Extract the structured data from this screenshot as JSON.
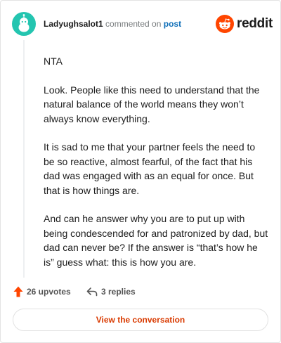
{
  "header": {
    "username": "Ladyughsalot1",
    "commented_on_text": "commented on",
    "post_link": "post",
    "brand_name": "reddit"
  },
  "comment": {
    "paragraphs": [
      "NTA",
      "Look. People like this need to understand that the natural balance of the world means they won’t always know everything.",
      "It is sad to me that your partner feels the need to be so reactive, almost fearful, of the fact that his dad was engaged with as an equal for once. But that is how things are.",
      "And can he answer why you are to put up with being condescended for and patronized by dad, but dad can never be? If the answer is “that’s how he is” guess what: this is how you are."
    ]
  },
  "actions": {
    "upvotes_label": "26 upvotes",
    "replies_label": "3 replies"
  },
  "cta_label": "View the conversation",
  "colors": {
    "avatar_bg": "#24c5b0",
    "brand_orange": "#ff4500",
    "link_blue": "#0f6fb8",
    "cta_text": "#d93a00"
  },
  "icons": {
    "avatar": "snoo-avatar-icon",
    "brand": "reddit-logo-icon",
    "upvote": "upvote-arrow-icon",
    "reply": "reply-arrow-icon"
  }
}
